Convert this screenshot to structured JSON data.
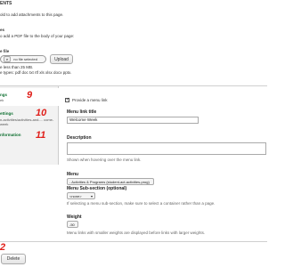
{
  "attachments": {
    "heading": "ENTS",
    "help": "old to add attachments to this page.",
    "images_heading": "es",
    "images_help": "o add a PDF file to the body of your page:",
    "file_heading": "e file",
    "choose_label": "e",
    "no_file": "no file selected",
    "upload": "Upload",
    "size_note": "e less than 25 MB.",
    "types_note": "e types: pdf doc txt rtf xls xlsx docx pptx."
  },
  "tabs": [
    {
      "title": "ngs",
      "summary": "ek",
      "marker": "9"
    },
    {
      "title": "ettings",
      "summary": "n-activities/activities-and-... come-week",
      "marker": "10"
    },
    {
      "title": "nformation",
      "summary": "",
      "marker": "11"
    }
  ],
  "menu_settings": {
    "provide_label": "Provide a menu link",
    "link_title_label": "Menu link title",
    "link_title_value": "Welcome Week",
    "description_label": "Description",
    "description_help": "Shown when hovering over the menu link.",
    "menu_label": "Menu",
    "menu_value": "- Activities & Programs (student-act-activities-prog)",
    "sub_section_label": "Menu Sub-section (optional)",
    "sub_section_value": "<none>",
    "sub_section_help": "If selecting a menu sub-section, make sure to select a container rather than a page.",
    "weight_label": "Weight",
    "weight_value": "-50",
    "weight_help": "Menu links with smaller weights are displayed before links with larger weights."
  },
  "footer": {
    "delete": "Delete",
    "marker": "2"
  }
}
